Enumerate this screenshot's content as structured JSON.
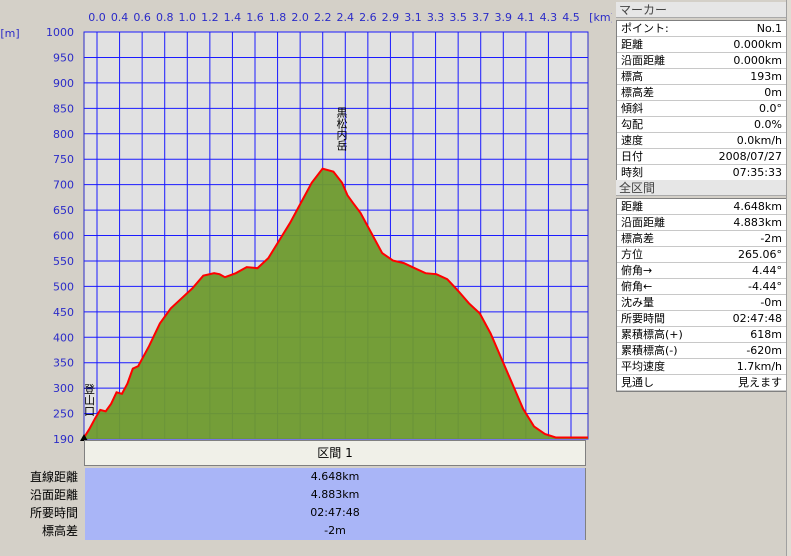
{
  "chart_data": {
    "type": "area",
    "x_unit": "[km]",
    "y_unit": "[m]",
    "x_ticks": [
      "0.0",
      "0.4",
      "0.6",
      "0.8",
      "1.0",
      "1.2",
      "1.4",
      "1.6",
      "1.8",
      "2.0",
      "2.2",
      "2.4",
      "2.6",
      "2.9",
      "3.1",
      "3.3",
      "3.5",
      "3.7",
      "3.9",
      "4.1",
      "4.3",
      "4.5"
    ],
    "y_ticks": [
      "1000",
      "950",
      "900",
      "850",
      "800",
      "750",
      "700",
      "650",
      "600",
      "550",
      "500",
      "450",
      "400",
      "350",
      "300",
      "250",
      "190"
    ],
    "ylim": [
      190,
      1000
    ],
    "xlim": [
      0,
      4.648
    ],
    "x": [
      0,
      0.05,
      0.1,
      0.15,
      0.2,
      0.25,
      0.3,
      0.35,
      0.4,
      0.45,
      0.5,
      0.6,
      0.7,
      0.8,
      0.9,
      1.0,
      1.1,
      1.2,
      1.25,
      1.3,
      1.4,
      1.5,
      1.6,
      1.7,
      1.8,
      1.9,
      2.0,
      2.1,
      2.2,
      2.3,
      2.38,
      2.43,
      2.48,
      2.55,
      2.65,
      2.75,
      2.85,
      2.95,
      3.05,
      3.15,
      3.25,
      3.35,
      3.45,
      3.55,
      3.65,
      3.75,
      3.85,
      3.95,
      4.05,
      4.15,
      4.25,
      4.35,
      4.45,
      4.55,
      4.648
    ],
    "y": [
      193,
      210,
      230,
      248,
      245,
      260,
      283,
      280,
      300,
      330,
      335,
      375,
      420,
      450,
      470,
      490,
      515,
      520,
      518,
      512,
      520,
      532,
      530,
      550,
      585,
      620,
      660,
      700,
      728,
      722,
      700,
      675,
      660,
      640,
      600,
      560,
      545,
      540,
      530,
      520,
      518,
      508,
      485,
      460,
      440,
      400,
      350,
      300,
      250,
      215,
      200,
      193,
      193,
      193,
      193
    ],
    "series": [
      {
        "values_ref": "y"
      }
    ],
    "annotations": [
      {
        "text": "黒松内岳",
        "x": 2.43,
        "y": 728
      },
      {
        "text": "登山口",
        "x": 0.0,
        "y": 193
      }
    ],
    "grid": true,
    "line_color": "#ff0000",
    "fill_color": "#6e9a2e",
    "bg_color": "#e1e1e1",
    "grid_color": "#1a1aff"
  },
  "segment": {
    "header": "区間 1",
    "rows": [
      {
        "label": "直線距離",
        "value": "4.648km"
      },
      {
        "label": "沿面距離",
        "value": "4.883km"
      },
      {
        "label": "所要時間",
        "value": "02:47:48"
      },
      {
        "label": "標高差",
        "value": "-2m"
      }
    ]
  },
  "marker_panel": {
    "title": "マーカー",
    "rows": [
      {
        "k": "ポイント:",
        "v": "No.1"
      },
      {
        "k": "距離",
        "v": "0.000km"
      },
      {
        "k": "沿面距離",
        "v": "0.000km"
      },
      {
        "k": "標高",
        "v": "193m"
      },
      {
        "k": "標高差",
        "v": "0m"
      },
      {
        "k": "傾斜",
        "v": "0.0°"
      },
      {
        "k": "勾配",
        "v": "0.0%"
      },
      {
        "k": "速度",
        "v": "0.0km/h"
      },
      {
        "k": "日付",
        "v": "2008/07/27"
      },
      {
        "k": "時刻",
        "v": "07:35:33"
      }
    ]
  },
  "all_panel": {
    "title": "全区間",
    "rows": [
      {
        "k": "距離",
        "v": "4.648km"
      },
      {
        "k": "沿面距離",
        "v": "4.883km"
      },
      {
        "k": "標高差",
        "v": "-2m"
      },
      {
        "k": "方位",
        "v": "265.06°"
      },
      {
        "k": "俯角→",
        "v": "4.44°"
      },
      {
        "k": "俯角←",
        "v": "-4.44°"
      },
      {
        "k": "沈み量",
        "v": "-0m"
      },
      {
        "k": "所要時間",
        "v": "02:47:48"
      },
      {
        "k": "累積標高(+)",
        "v": "618m"
      },
      {
        "k": "累積標高(-)",
        "v": "-620m"
      },
      {
        "k": "平均速度",
        "v": "1.7km/h"
      },
      {
        "k": "見通し",
        "v": "見えます"
      }
    ]
  }
}
